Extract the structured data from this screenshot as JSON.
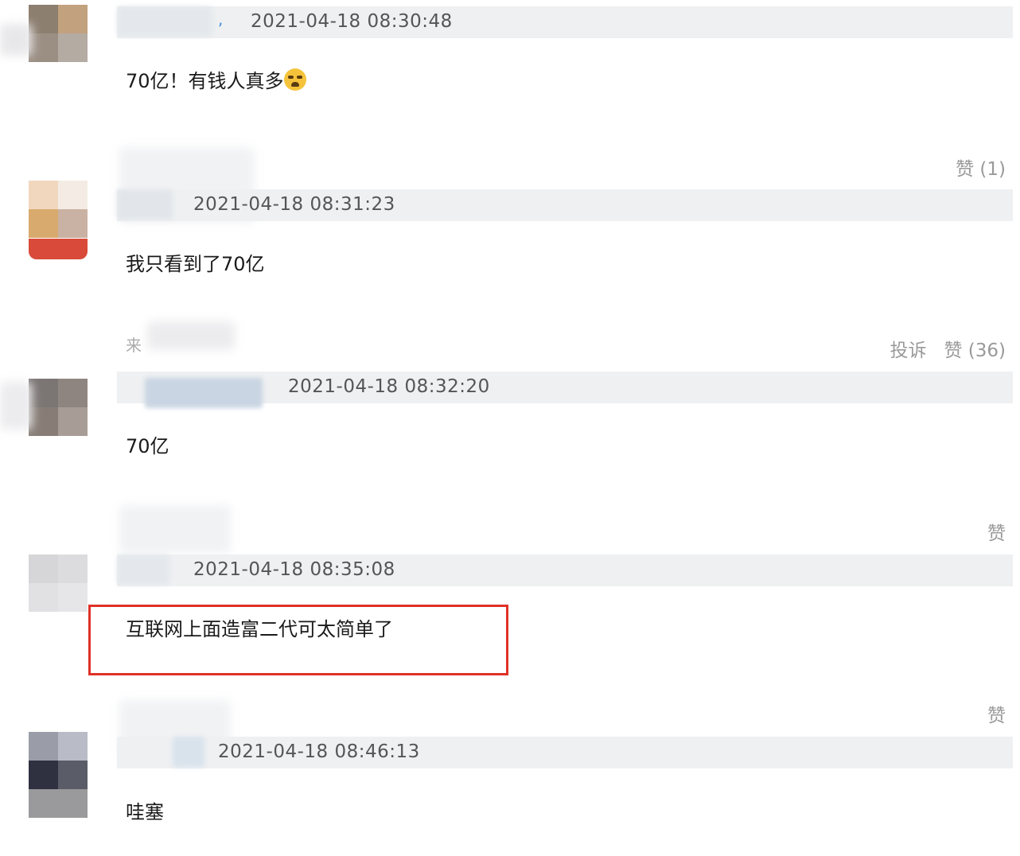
{
  "comments": [
    {
      "timestamp": "2021-04-18 08:30:48",
      "text": "70亿！有钱人真多",
      "emoji": "crying-emoji",
      "actions": {
        "like": "赞 (1)"
      }
    },
    {
      "timestamp": "2021-04-18 08:31:23",
      "text": "我只看到了70亿",
      "source_fragment": "来",
      "actions": {
        "report": "投诉",
        "like": "赞 (36)"
      }
    },
    {
      "timestamp": "2021-04-18 08:32:20",
      "text": "70亿",
      "actions": {
        "like": "赞"
      }
    },
    {
      "timestamp": "2021-04-18 08:35:08",
      "text": "互联网上面造富二代可太简单了",
      "highlight_color": "#e03127",
      "actions": {
        "like": "赞"
      }
    },
    {
      "timestamp": "2021-04-18 08:46:13",
      "text": "哇塞"
    }
  ],
  "colors": {
    "meta_bar": "#eef0f2",
    "timestamp": "#555555",
    "action": "#9a9a9a",
    "highlight": "#e03127"
  }
}
